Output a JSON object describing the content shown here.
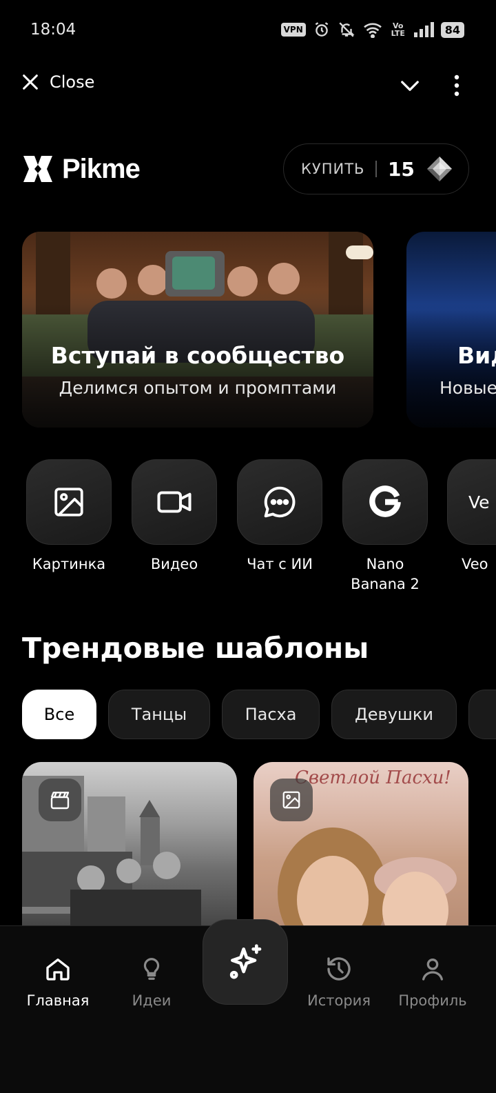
{
  "status_bar": {
    "time": "18:04",
    "vpn": "VPN",
    "network": "Vo LTE",
    "battery": "84",
    "icons": [
      "vpn-icon",
      "alarm-icon",
      "mute-icon",
      "wifi-icon",
      "volte-icon",
      "signal-icon",
      "battery-icon"
    ]
  },
  "top_bar": {
    "close_label": "Close",
    "icons": [
      "close-icon",
      "chevron-down-icon",
      "more-vertical-icon"
    ]
  },
  "header": {
    "logo_text": "Pikme",
    "buy_label": "КУПИТЬ",
    "credits": "15",
    "credits_icon": "diamond-icon"
  },
  "banners": [
    {
      "title": "Вступай в сообщество",
      "subtitle": "Делимся опытом и промптами"
    },
    {
      "title": "Вид",
      "subtitle": "Новые"
    }
  ],
  "actions": [
    {
      "label": "Картинка",
      "icon": "image-icon"
    },
    {
      "label": "Видео",
      "icon": "video-camera-icon"
    },
    {
      "label": "Чат с ИИ",
      "icon": "chat-icon"
    },
    {
      "label": "Nano Banana 2",
      "icon": "google-icon"
    },
    {
      "label": "Veo",
      "icon": "veo-icon",
      "tile_text": "Ve"
    }
  ],
  "section_title": "Трендовые шаблоны",
  "chips": [
    {
      "label": "Все",
      "active": true
    },
    {
      "label": "Танцы",
      "active": false
    },
    {
      "label": "Пасха",
      "active": false
    },
    {
      "label": "Девушки",
      "active": false
    }
  ],
  "cards": [
    {
      "type_icon": "clapperboard-icon"
    },
    {
      "type_icon": "image-icon",
      "caption": "Светлой Пасхи!"
    }
  ],
  "bottom_nav": {
    "items": [
      {
        "label": "Главная",
        "icon": "home-icon",
        "active": true
      },
      {
        "label": "Идеи",
        "icon": "lightbulb-icon",
        "active": false
      },
      {
        "label": "История",
        "icon": "history-icon",
        "active": false
      },
      {
        "label": "Профиль",
        "icon": "profile-icon",
        "active": false
      }
    ],
    "center_icon": "sparkles-icon"
  },
  "colors": {
    "background": "#000000",
    "surface": "#1a1a1a",
    "active_chip": "#ffffff",
    "inactive_nav": "#8a8a8a"
  }
}
